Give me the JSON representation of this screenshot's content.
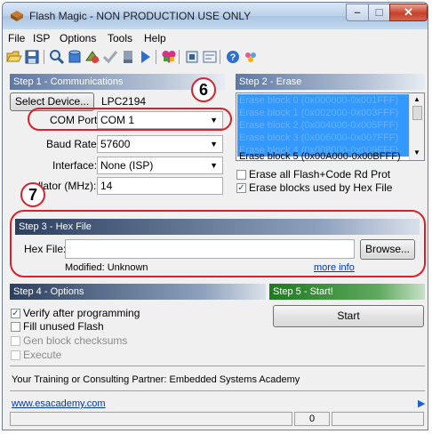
{
  "window": {
    "title": "Flash Magic - NON PRODUCTION USE ONLY",
    "min_glyph": "–",
    "max_glyph": "□",
    "close_glyph": "✕"
  },
  "menu": [
    "File",
    "ISP",
    "Options",
    "Tools",
    "Help"
  ],
  "toolbar_icons": [
    "open-folder-icon",
    "save-icon",
    "search-icon",
    "database-icon",
    "blank-check-icon",
    "verify-checkmark-icon",
    "erase-icon",
    "go-arrow-icon",
    "heart-icon",
    "chip-icon",
    "hex-view-icon",
    "help-icon",
    "community-icon"
  ],
  "step1": {
    "header": "Step 1 - Communications",
    "select_device_label": "Select Device...",
    "device": "LPC2194",
    "com_port_label": "COM Port:",
    "com_port_value": "COM 1",
    "baud_label": "Baud Rate:",
    "baud_value": "57600",
    "interface_label": "Interface:",
    "interface_value": "None (ISP)",
    "oscillator_label": "llator (MHz):",
    "oscillator_value": "14"
  },
  "step2": {
    "header": "Step 2 - Erase",
    "blocks": [
      "Erase block 0 (0x000000-0x001FFF)",
      "Erase block 1 (0x002000-0x003FFF)",
      "Erase block 2 (0x004000-0x005FFF)",
      "Erase block 3 (0x006000-0x007FFF)",
      "Erase block 4 (0x008000-0x009FFF)",
      "Erase block 5 (0x00A000-0x00BFFF)"
    ],
    "erase_all_label": "Erase all Flash+Code Rd Prot",
    "erase_used_label": "Erase blocks used by Hex File",
    "erase_all_checked": false,
    "erase_used_checked": true
  },
  "step3": {
    "header": "Step 3 - Hex File",
    "hex_file_label": "Hex File:",
    "hex_file_value": "",
    "browse_label": "Browse...",
    "modified_text": "Modified: Unknown",
    "more_info": "more info"
  },
  "step4": {
    "header": "Step 4 - Options",
    "options": [
      {
        "label": "Verify after programming",
        "checked": true,
        "enabled": true
      },
      {
        "label": "Fill unused Flash",
        "checked": false,
        "enabled": true
      },
      {
        "label": "Gen block checksums",
        "checked": false,
        "enabled": false
      },
      {
        "label": "Execute",
        "checked": false,
        "enabled": false
      }
    ]
  },
  "step5": {
    "header": "Step 5 - Start!",
    "start_label": "Start"
  },
  "partner_text": "Your Training or Consulting Partner: Embedded Systems Academy",
  "partner_link": "www.esacademy.com",
  "status": {
    "counter": "0"
  },
  "annotations": {
    "marker6": "6",
    "marker7": "7"
  },
  "colors": {
    "annotation_red": "#d6222a",
    "list_selection": "#3399ff",
    "step5_green": "#1e7a1e"
  }
}
